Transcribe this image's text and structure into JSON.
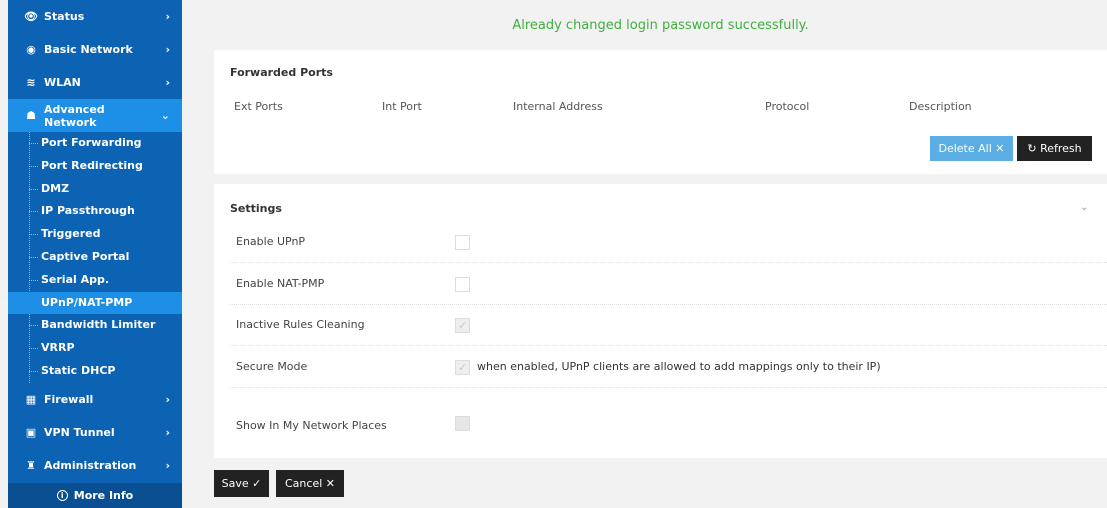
{
  "sidebar": {
    "top_items": [
      {
        "label": "Status",
        "icon": "eye-icon"
      },
      {
        "label": "Basic Network",
        "icon": "globe-icon"
      },
      {
        "label": "WLAN",
        "icon": "wifi-icon"
      },
      {
        "label": "Advanced Network",
        "icon": "network-icon"
      }
    ],
    "sub_items": [
      "Port Forwarding",
      "Port Redirecting",
      "DMZ",
      "IP Passthrough",
      "Triggered",
      "Captive Portal",
      "Serial App.",
      "UPnP/NAT-PMP",
      "Bandwidth Limiter",
      "VRRP",
      "Static DHCP"
    ],
    "bottom_items": [
      {
        "label": "Firewall",
        "icon": "firewall-icon"
      },
      {
        "label": "VPN Tunnel",
        "icon": "vpn-icon"
      },
      {
        "label": "Administration",
        "icon": "admin-icon"
      }
    ],
    "more_info": "More Info"
  },
  "notice": "Already changed login password successfully.",
  "forwarded": {
    "title": "Forwarded Ports",
    "columns": [
      "Ext Ports",
      "Int Port",
      "Internal Address",
      "Protocol",
      "Description"
    ],
    "delete_all": "Delete All ✕",
    "refresh": "↻ Refresh"
  },
  "settings": {
    "title": "Settings",
    "rows": [
      {
        "label": "Enable UPnP",
        "checked": false
      },
      {
        "label": "Enable NAT-PMP",
        "checked": false
      },
      {
        "label": "Inactive Rules Cleaning",
        "checked": true
      },
      {
        "label": "Secure Mode",
        "checked": true,
        "hint": "when enabled, UPnP clients are allowed to add mappings only to their IP)"
      },
      {
        "label": "Show In My Network Places",
        "checked": false
      }
    ]
  },
  "actions": {
    "save": "Save ✓",
    "cancel": "Cancel ✕"
  },
  "colors": {
    "sidebar": "#0c63b4",
    "sidebar_active": "#1e8fe6",
    "notice": "#3fae3f",
    "delete_button": "#5aaee3"
  }
}
